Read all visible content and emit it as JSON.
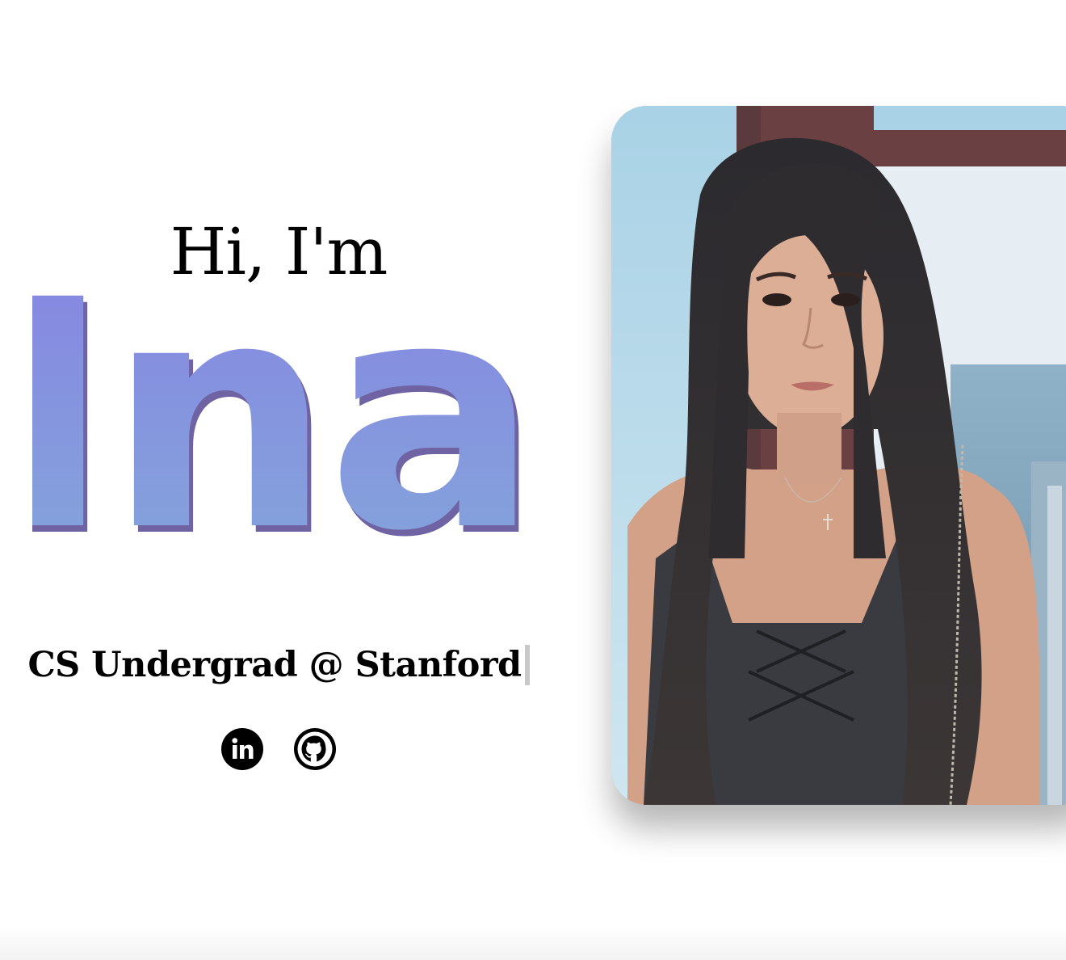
{
  "hero": {
    "greeting": "Hi, I'm",
    "name": "Ina",
    "tagline": "CS Undergrad @ Stanford",
    "colors": {
      "name_gradient_top": "#8683e2",
      "name_gradient_bottom": "#84a8da",
      "name_shadow": "#6f63a4"
    }
  },
  "socials": [
    {
      "label": "LinkedIn",
      "icon": "linkedin-icon"
    },
    {
      "label": "GitHub",
      "icon": "github-icon"
    }
  ],
  "photo": {
    "alt": "Portrait photo"
  }
}
